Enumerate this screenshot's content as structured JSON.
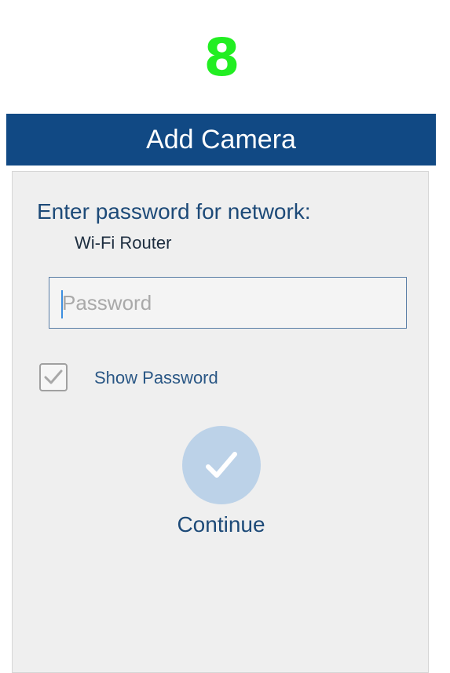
{
  "step": {
    "number": "8",
    "color": "#22ee22"
  },
  "header": {
    "title": "Add Camera",
    "background": "#114984"
  },
  "form": {
    "prompt": "Enter password for network:",
    "network_name": "Wi-Fi Router",
    "password": {
      "value": "",
      "placeholder": "Password"
    },
    "show_password": {
      "label": "Show Password",
      "checked": true
    },
    "continue": {
      "label": "Continue",
      "icon": "checkmark-icon",
      "color": "#bcd2e8"
    }
  }
}
